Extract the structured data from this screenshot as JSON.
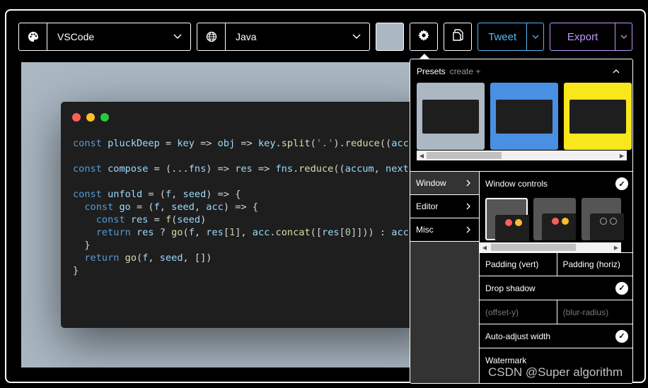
{
  "toolbar": {
    "theme": {
      "value": "VSCode",
      "icon": "palette-icon"
    },
    "language": {
      "value": "Java",
      "icon": "globe-icon"
    },
    "background_color": "#abb8c3",
    "tweet_label": "Tweet",
    "export_label": "Export"
  },
  "editor": {
    "controls": [
      "#ff5f56",
      "#ffbd2e",
      "#27c93f"
    ],
    "background": "#1e1e1e"
  },
  "settings": {
    "presets_label": "Presets",
    "create_label": "create +",
    "preset_colors": [
      "#abb8c3",
      "#4a90e2",
      "#f8e71c"
    ],
    "menu": [
      {
        "label": "Window"
      },
      {
        "label": "Editor"
      },
      {
        "label": "Misc"
      }
    ],
    "window_controls_label": "Window controls",
    "padding_vert_label": "Padding (vert)",
    "padding_horiz_label": "Padding (horiz)",
    "drop_shadow_label": "Drop shadow",
    "offset_y_placeholder": "(offset-y)",
    "blur_radius_placeholder": "(blur-radius)",
    "auto_adjust_label": "Auto-adjust width",
    "watermark_label": "Watermark"
  },
  "overlay_watermark": "CSDN @Super algorithm"
}
